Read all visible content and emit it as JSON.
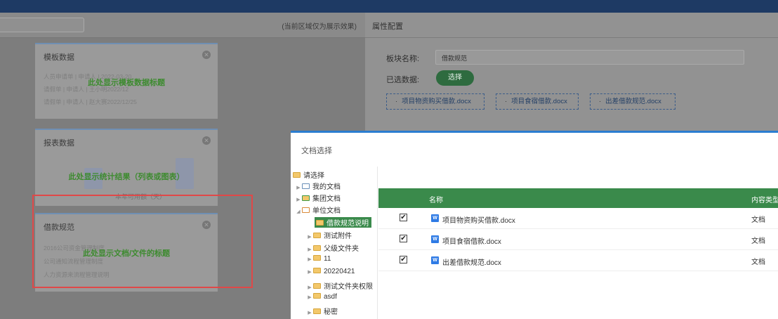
{
  "left_panel": {
    "preview_note": "(当前区域仅为展示效果)",
    "cards": [
      {
        "title": "模板数据",
        "overlay": "此处显示模板数据标题",
        "lines": [
          "人员申请单 | 申请人 | 2022-03-20",
          "请假单 | 申请人 | 王小明2022/12",
          "请假单 | 申请人 | 赵大赛2022/12/25"
        ]
      },
      {
        "title": "报表数据",
        "overlay": "此处显示统计结果（列表或图表）",
        "lines": [
          "本年可用额（天）"
        ]
      },
      {
        "title": "借款规范",
        "overlay": "此处显示文档/文件的标题",
        "lines": [
          "2016公司资金管理制度",
          "公司通知流程管理制度",
          "人力资源来流程管理说明"
        ]
      }
    ]
  },
  "config_panel": {
    "title": "属性配置",
    "block_name_label": "板块名称:",
    "block_name_value": "借款规范",
    "selected_data_label": "已选数据:",
    "choose_button": "选择",
    "selected_docs": [
      "项目物资购买借款.docx",
      "项目食宿借款.docx",
      "出差借款规范.docx"
    ]
  },
  "modal": {
    "title": "文档选择",
    "tree": {
      "root": "请选择",
      "items": [
        {
          "label": "我的文档",
          "kind": "my",
          "level": 1,
          "expanded": false
        },
        {
          "label": "集团文档",
          "kind": "group",
          "level": 1,
          "expanded": false
        },
        {
          "label": "单位文档",
          "kind": "unit",
          "level": 1,
          "expanded": true
        },
        {
          "label": "借款规范说明",
          "kind": "folder",
          "level": 2,
          "selected": true
        },
        {
          "label": "测试附件",
          "kind": "folder",
          "level": 2
        },
        {
          "label": "父级文件夹",
          "kind": "folder",
          "level": 2
        },
        {
          "label": "11",
          "kind": "folder",
          "level": 2
        },
        {
          "label": "20220421",
          "kind": "folder",
          "level": 2
        },
        {
          "label": "测试文件夹权限",
          "kind": "folder",
          "level": 2
        },
        {
          "label": "asdf",
          "kind": "folder",
          "level": 2
        },
        {
          "label": "秘密",
          "kind": "folder",
          "level": 2
        }
      ]
    },
    "table": {
      "columns": [
        "名称",
        "内容类型"
      ],
      "rows": [
        {
          "checked": "✔",
          "icon": "W",
          "name": "项目物资购买借款.docx",
          "type": "文档"
        },
        {
          "checked": "✔",
          "icon": "W",
          "name": "项目食宿借款.docx",
          "type": "文档"
        },
        {
          "checked": "✔",
          "icon": "W",
          "name": "出差借款规范.docx",
          "type": "文档"
        }
      ]
    }
  }
}
